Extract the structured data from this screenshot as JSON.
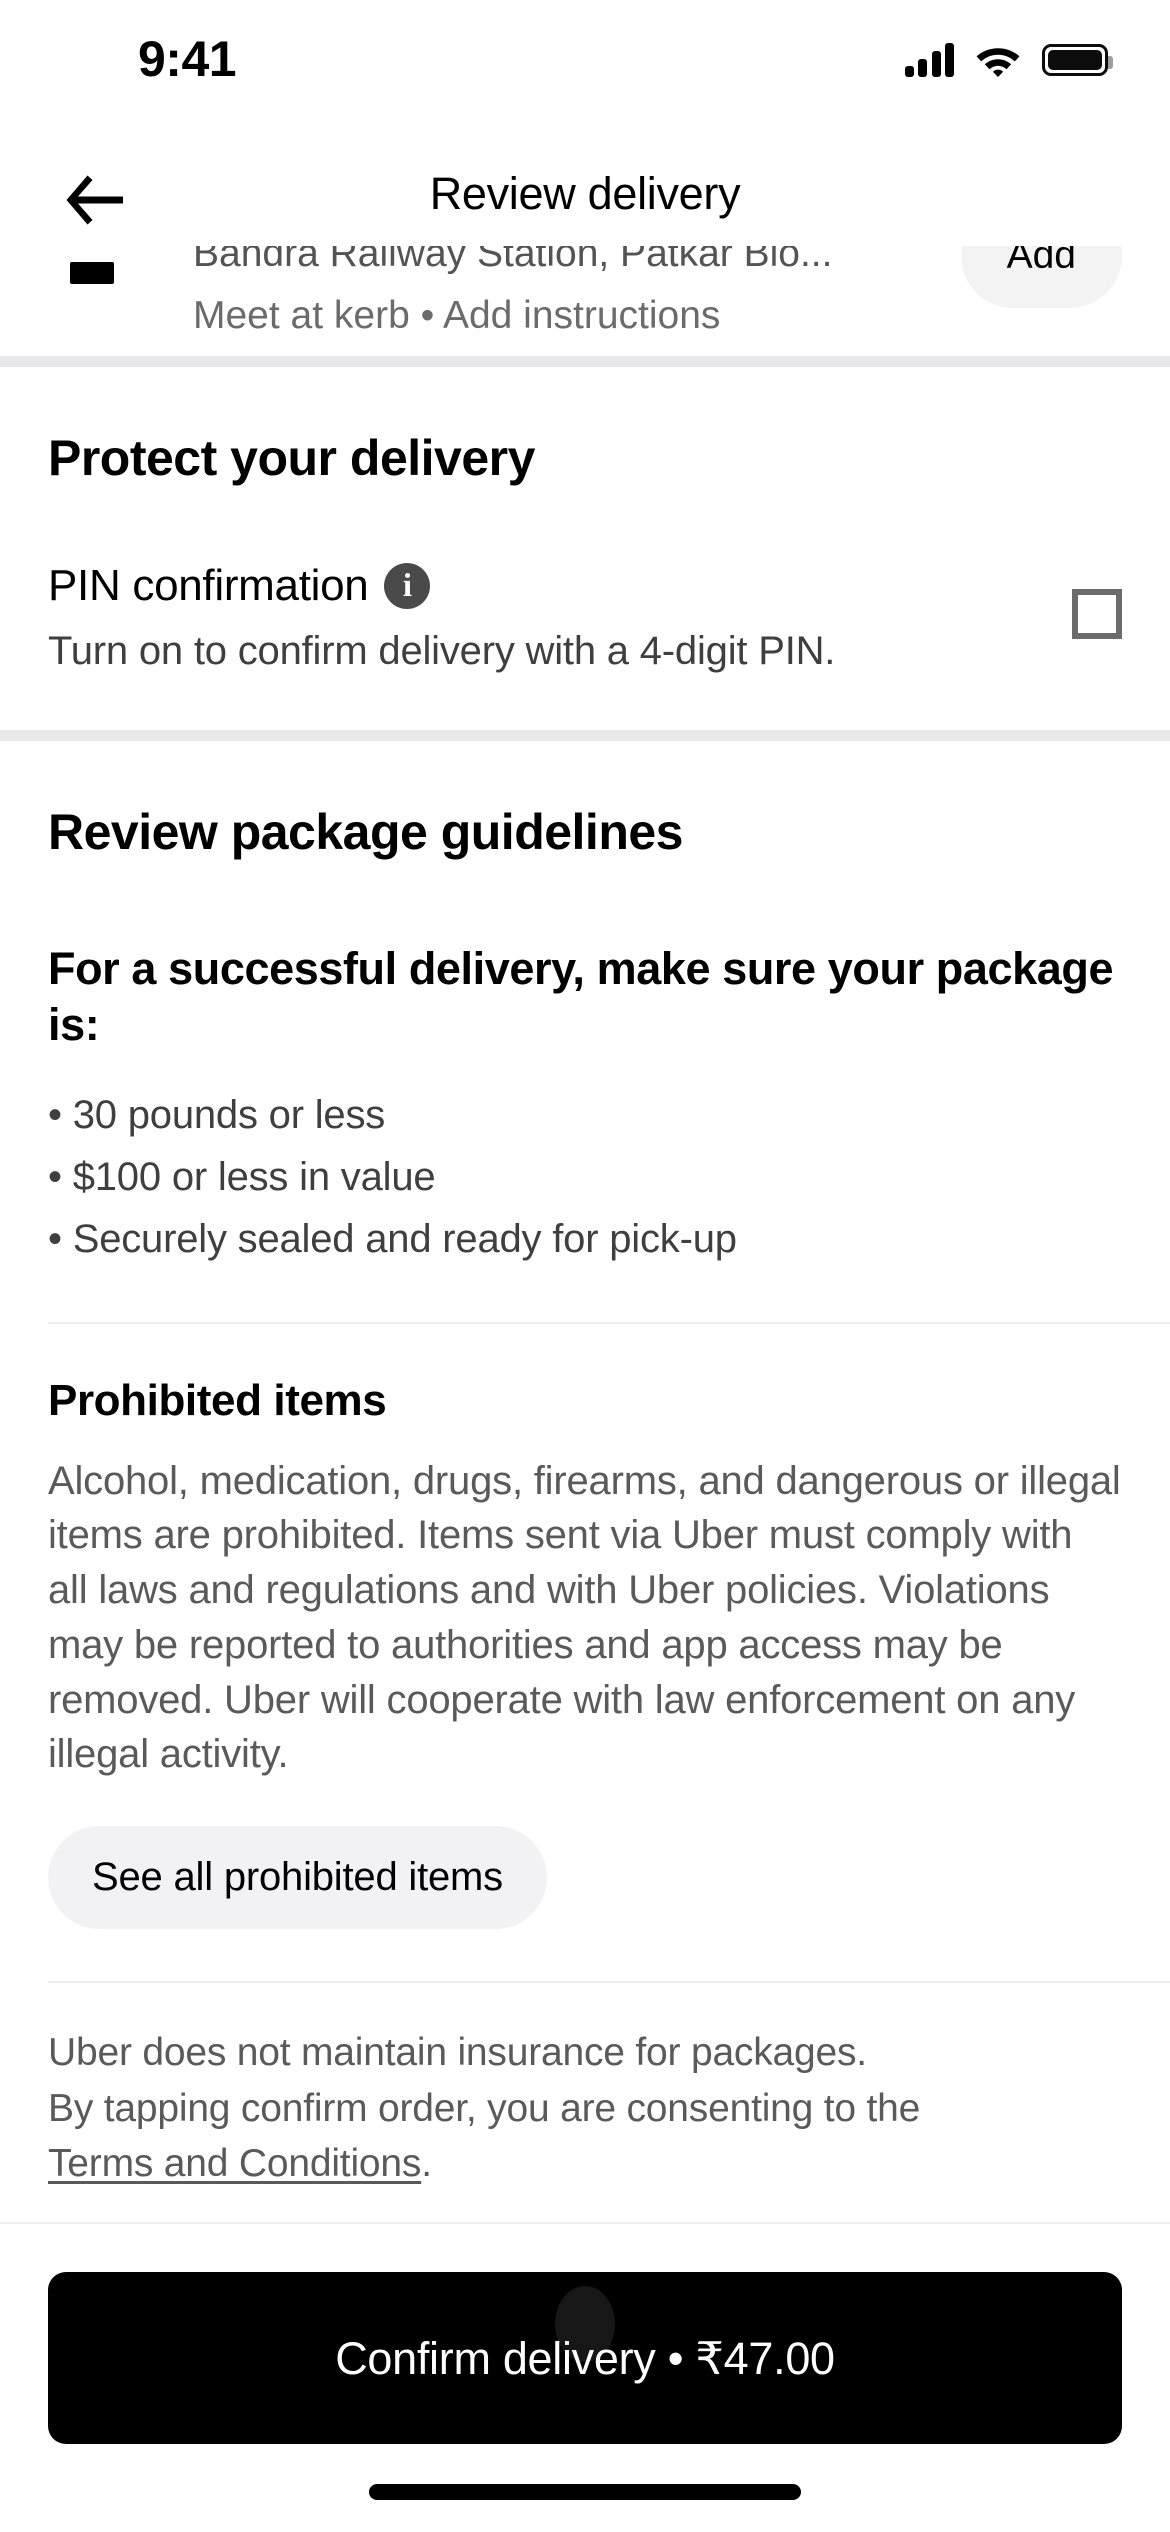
{
  "status_bar": {
    "time": "9:41",
    "icons": [
      "cellular-signal-icon",
      "wifi-icon",
      "battery-icon"
    ]
  },
  "header": {
    "back_icon": "back-arrow-icon",
    "title": "Review delivery"
  },
  "address_row": {
    "marker_icon": "destination-marker-icon",
    "address": "Bandra Railway Station, Patkar Blo...",
    "subtitle": "Meet at kerb • Add instructions",
    "add_button_label": "Add"
  },
  "protect_section": {
    "heading": "Protect your delivery",
    "pin": {
      "title": "PIN confirmation",
      "info_icon": "info-icon",
      "description": "Turn on to confirm delivery with a 4-digit PIN.",
      "checkbox_checked": false
    }
  },
  "guidelines_section": {
    "heading": "Review package guidelines",
    "lead": "For a successful delivery, make sure your package is:",
    "bullets": [
      "• 30 pounds or less",
      "• $100 or less in value",
      "• Securely sealed and ready for pick-up"
    ]
  },
  "prohibited_section": {
    "heading": "Prohibited items",
    "paragraph": "Alcohol, medication, drugs, firearms, and dangerous or illegal items are prohibited. Items sent via Uber must comply with all laws and regulations and with Uber policies. Violations may be reported to authorities and app access may be removed. Uber will cooperate with law enforcement on any illegal activity.",
    "see_all_label": "See all prohibited items"
  },
  "legal": {
    "line1": "Uber does not maintain insurance for packages.",
    "line2": "By tapping confirm order, you are consenting to the",
    "link_text": "Terms and Conditions",
    "trailing": "."
  },
  "cta": {
    "label": "Confirm delivery • ₹47.00"
  },
  "colors": {
    "accent": "#000000",
    "divider": "#e8e8ea",
    "pill_bg": "#f2f2f4",
    "muted_text": "#5a5a5a"
  }
}
